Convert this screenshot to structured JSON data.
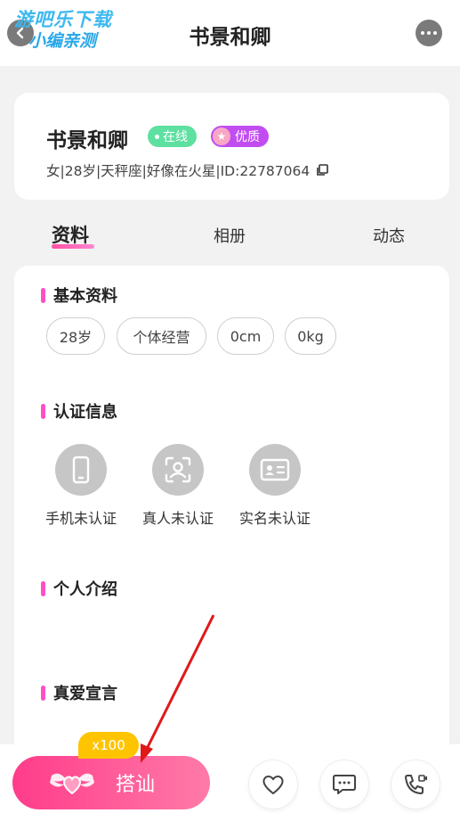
{
  "header": {
    "title": "书景和卿",
    "watermark_line1": "游吧乐下载",
    "watermark_line2": "小编亲测"
  },
  "profile": {
    "name": "书景和卿",
    "badge_online": "在线",
    "badge_quality": "优质",
    "info": "女|28岁|天秤座|好像在火星|ID:22787064"
  },
  "tabs": [
    {
      "label": "资料",
      "active": true
    },
    {
      "label": "相册",
      "active": false
    },
    {
      "label": "动态",
      "active": false
    }
  ],
  "sections": {
    "basic_title": "基本资料",
    "basic_tags": [
      "28岁",
      "个体经营",
      "0cm",
      "0kg"
    ],
    "cert_title": "认证信息",
    "certs": [
      {
        "label": "手机未认证",
        "icon": "phone-icon"
      },
      {
        "label": "真人未认证",
        "icon": "face-scan-icon"
      },
      {
        "label": "实名未认证",
        "icon": "id-card-icon"
      }
    ],
    "intro_title": "个人介绍",
    "love_title": "真爱宣言"
  },
  "bottom": {
    "chat_label": "搭讪",
    "cost_badge": "x100"
  },
  "colors": {
    "accent": "#ff4fc3",
    "online": "#5de0a0",
    "quality": "#c14df0",
    "chat_gradient_start": "#ff3c8a",
    "cost_badge": "#ffc400"
  }
}
